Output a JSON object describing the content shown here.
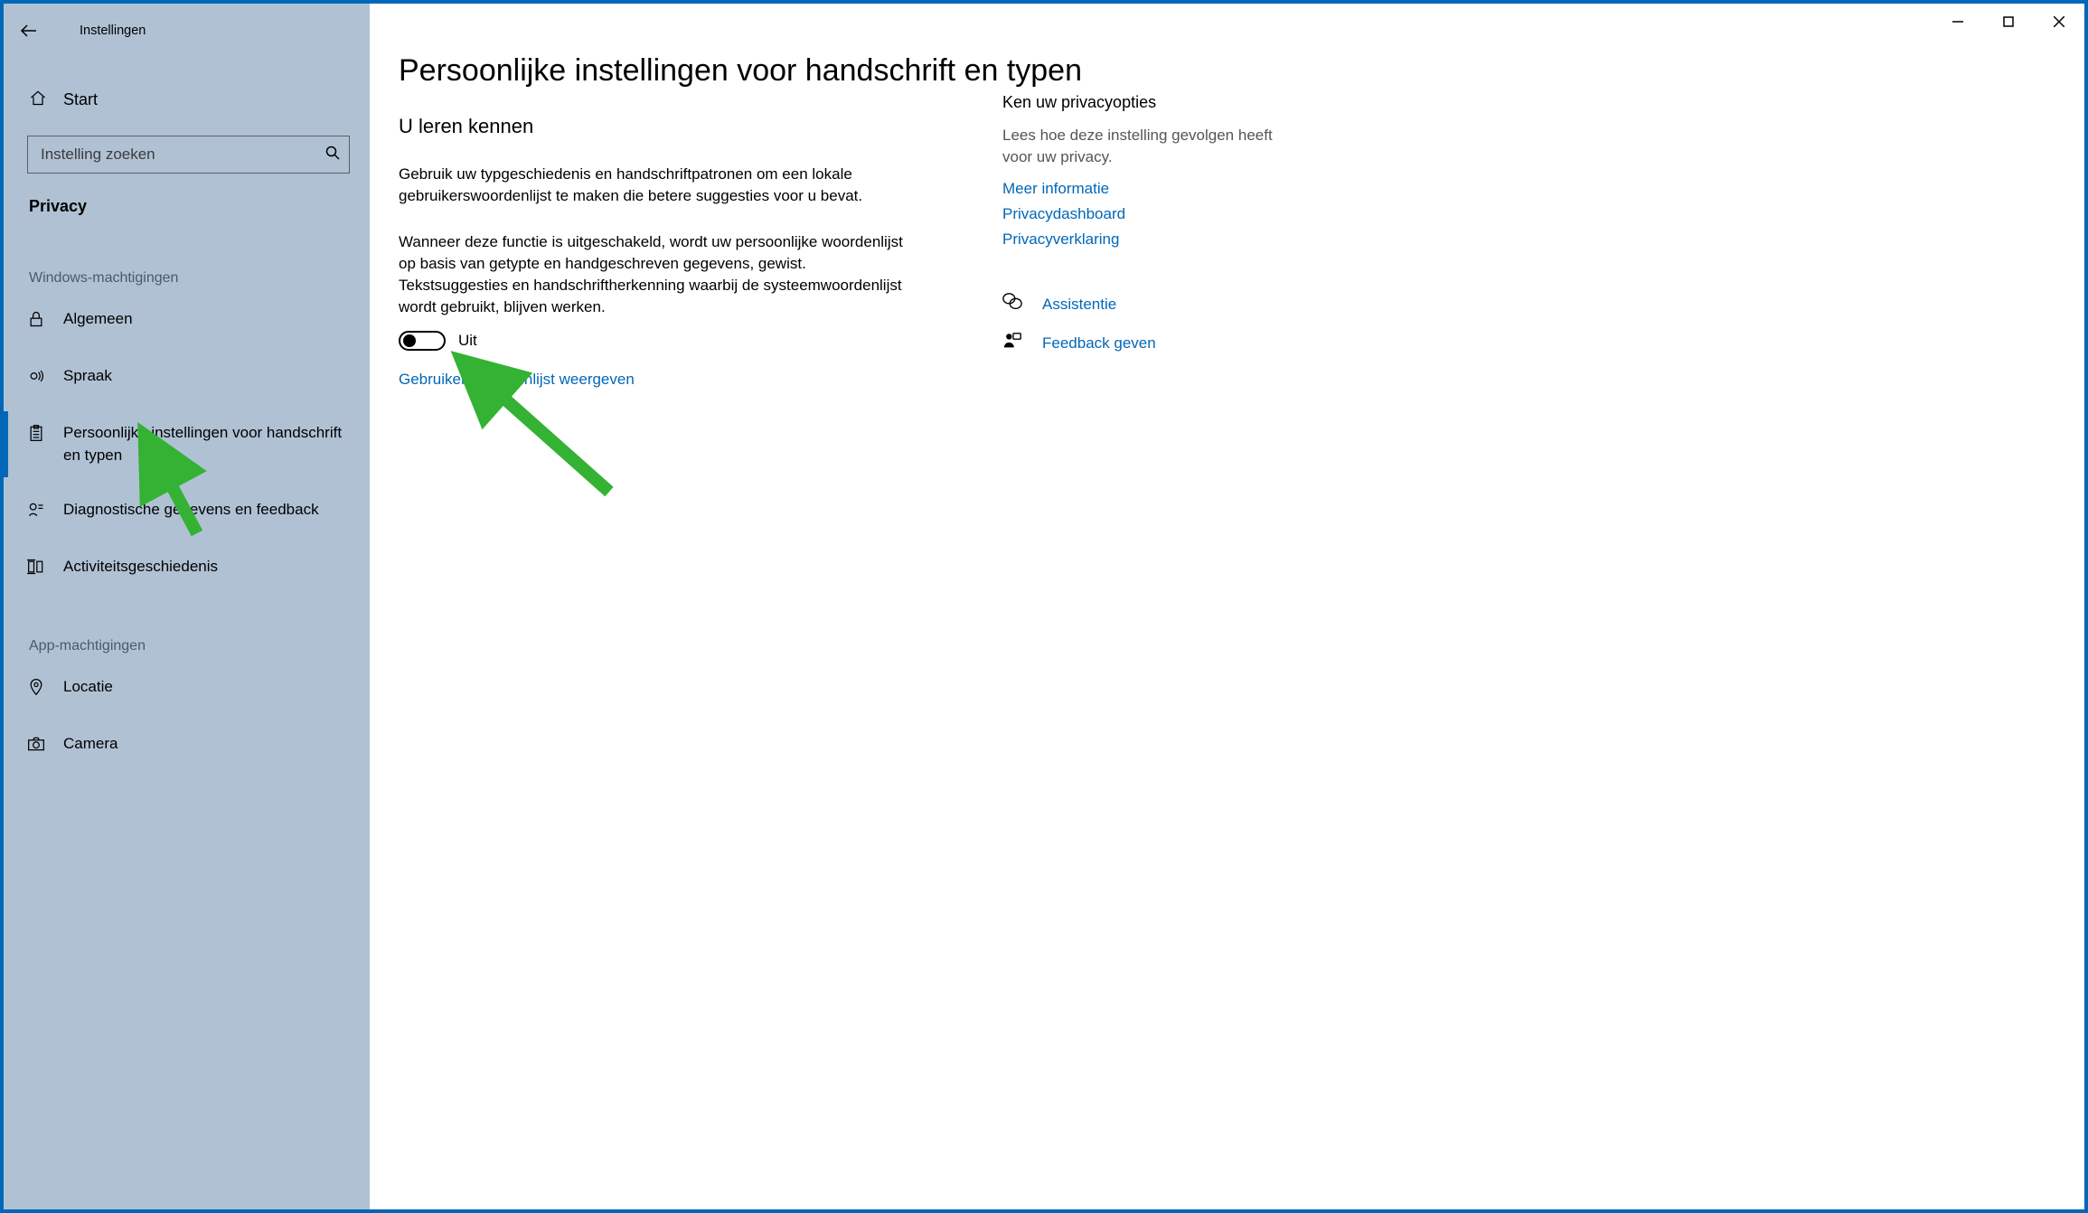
{
  "window": {
    "app_title": "Instellingen"
  },
  "sidebar": {
    "home_label": "Start",
    "search_placeholder": "Instelling zoeken",
    "category": "Privacy",
    "group_windows": "Windows-machtigingen",
    "group_app": "App-machtigingen",
    "items_windows": [
      {
        "label": "Algemeen"
      },
      {
        "label": "Spraak"
      },
      {
        "label": "Persoonlijke instellingen voor handschrift en typen"
      },
      {
        "label": "Diagnostische gegevens en feedback"
      },
      {
        "label": "Activiteitsgeschiedenis"
      }
    ],
    "items_app": [
      {
        "label": "Locatie"
      },
      {
        "label": "Camera"
      }
    ]
  },
  "main": {
    "title": "Persoonlijke instellingen voor handschrift en typen",
    "section_title": "U leren kennen",
    "para1": "Gebruik uw typgeschiedenis en handschriftpatronen om een lokale gebruikerswoordenlijst te maken die betere suggesties voor u bevat.",
    "para2": "Wanneer deze functie is uitgeschakeld, wordt uw persoonlijke woordenlijst op basis van getypte en handgeschreven gegevens, gewist. Tekstsuggesties en handschriftherkenning waarbij de systeemwoordenlijst wordt gebruikt, blijven werken.",
    "toggle_state": "Uit",
    "link_dictionary": "Gebruikerswoordenlijst weergeven"
  },
  "aside": {
    "title": "Ken uw privacyopties",
    "text": "Lees hoe deze instelling gevolgen heeft voor uw privacy.",
    "links": [
      "Meer informatie",
      "Privacydashboard",
      "Privacyverklaring"
    ],
    "actions": [
      "Assistentie",
      "Feedback geven"
    ]
  }
}
